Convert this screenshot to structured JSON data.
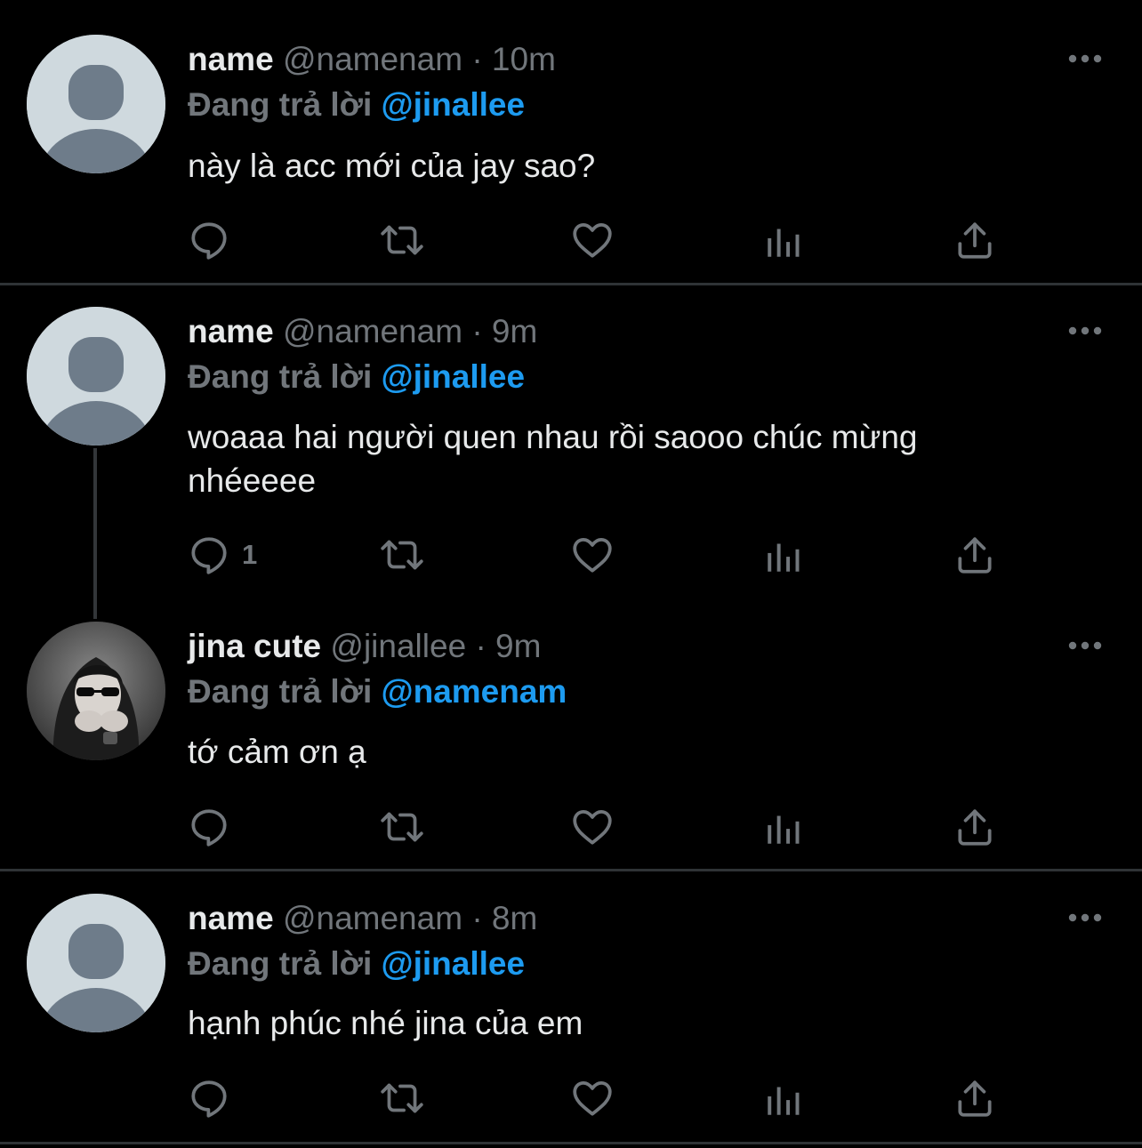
{
  "tweets": [
    {
      "name": "name",
      "handle": "@namenam",
      "sep": "·",
      "time": "10m",
      "reply_prefix": "Đang trả lời",
      "reply_handle": "@jinallee",
      "text": "này là acc mới của jay sao?",
      "reply_count": "",
      "avatar": "default-profile"
    },
    {
      "name": "name",
      "handle": "@namenam",
      "sep": "·",
      "time": "9m",
      "reply_prefix": "Đang trả lời",
      "reply_handle": "@jinallee",
      "text": "woaaa hai người quen nhau rồi saooo chúc mừng nhéeeee",
      "reply_count": "1",
      "avatar": "default-profile"
    },
    {
      "name": "jina cute",
      "handle": "@jinallee",
      "sep": "·",
      "time": "9m",
      "reply_prefix": "Đang trả lời",
      "reply_handle": "@namenam",
      "text": "tớ cảm ơn ạ",
      "reply_count": "",
      "avatar": "user-photo"
    },
    {
      "name": "name",
      "handle": "@namenam",
      "sep": "·",
      "time": "8m",
      "reply_prefix": "Đang trả lời",
      "reply_handle": "@jinallee",
      "text": "hạnh phúc nhé jina của em",
      "reply_count": "",
      "avatar": "default-profile"
    }
  ],
  "icons": {
    "reply": "reply-icon",
    "retweet": "retweet-icon",
    "like": "heart-icon",
    "views": "views-icon",
    "share": "share-icon",
    "more": "more-icon"
  },
  "colors": {
    "background": "#000000",
    "text": "#e7e9ea",
    "muted": "#71767b",
    "accent": "#1d9bf0",
    "divider": "#2f3336"
  }
}
